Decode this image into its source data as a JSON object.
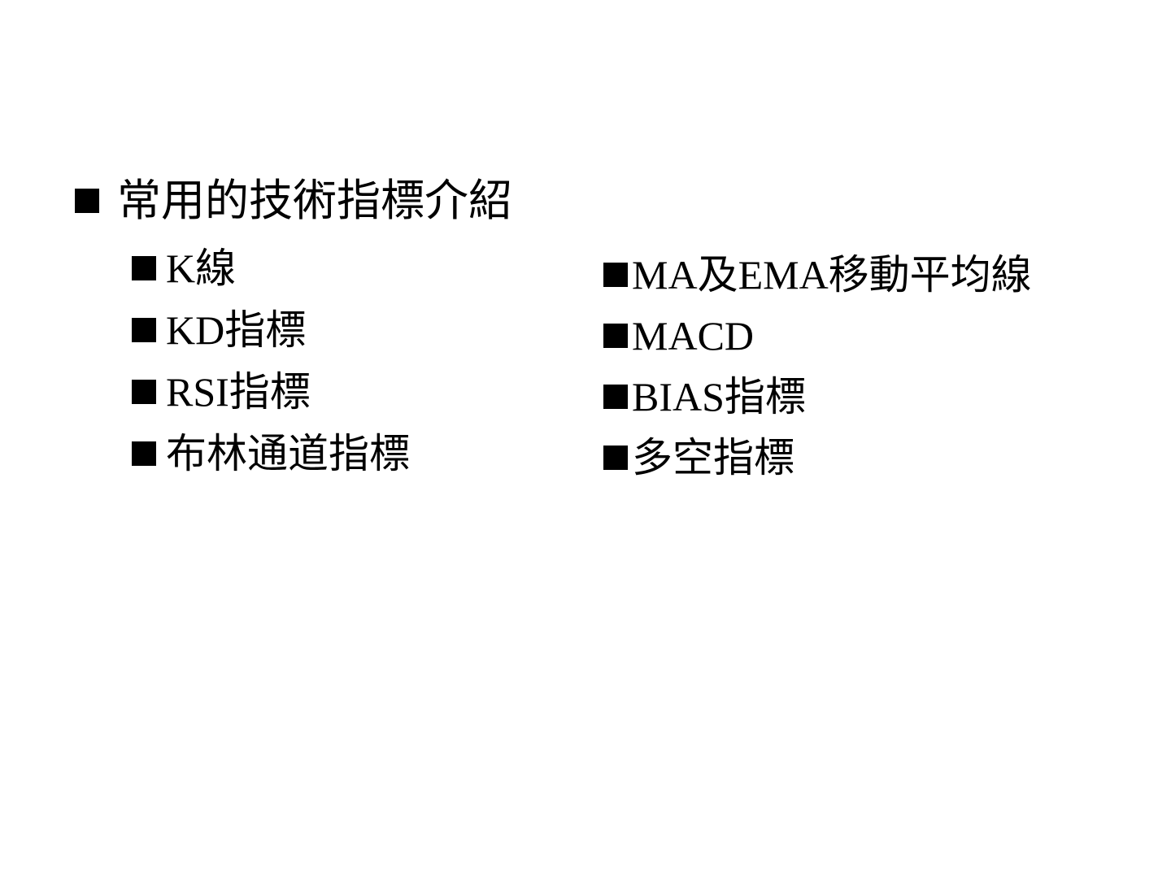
{
  "slide": {
    "heading": "常用的技術指標介紹",
    "left_items": [
      {
        "label": "K線"
      },
      {
        "label": "KD指標"
      },
      {
        "label": "RSI指標"
      },
      {
        "label": "布林通道指標"
      }
    ],
    "right_items": [
      {
        "label": "MA及EMA移動平均線"
      },
      {
        "label": "MACD"
      },
      {
        "label": "BIAS指標"
      },
      {
        "label": "多空指標"
      }
    ]
  }
}
